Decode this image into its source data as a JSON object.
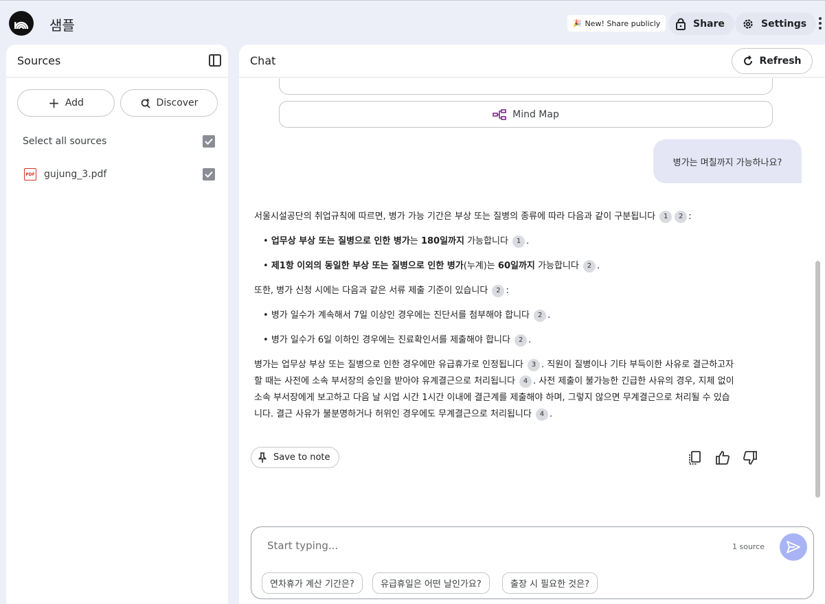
{
  "header": {
    "title": "샘플",
    "new_share": "New! Share publicly",
    "share_label": "Share",
    "settings_label": "Settings"
  },
  "sources": {
    "title": "Sources",
    "add_label": "Add",
    "discover_label": "Discover",
    "select_all_label": "Select all sources",
    "select_all_checked": true,
    "files": [
      {
        "name": "gujung_3.pdf",
        "type": "pdf",
        "checked": true
      }
    ]
  },
  "chat": {
    "title": "Chat",
    "refresh_label": "Refresh",
    "mind_map_label": "Mind Map",
    "user_question": "병가는 며칠까지 가능하나요?",
    "answer": {
      "intro": "서울시설공단의 취업규칙에 따르면, 병가 가능 기간은 부상 또는 질병의 종류에 따라 다음과 같이 구분됩니다",
      "b1_bold": "업무상 부상 또는 질병으로 인한 병가",
      "b1_mid": "는 ",
      "b1_bold2": "180일까지",
      "b1_end": " 가능합니다",
      "b2_bold": "제1항 이외의 동일한 부상 또는 질병으로 인한 병가",
      "b2_mid": "(누계)는 ",
      "b2_bold2": "60일까지",
      "b2_end": " 가능합니다",
      "docs_intro": "또한, 병가 신청 시에는 다음과 같은 서류 제출 기준이 있습니다",
      "d1": "병가 일수가 계속해서 7일 이상인 경우에는 진단서를 첨부해야 합니다",
      "d2": "병가 일수가 6일 이하인 경우에는 진료확인서를 제출해야 합니다",
      "p_line1a": "병가는 업무상 부상 또는 질병으로 인한 경우에만 유급휴가로 인정됩니다",
      "p_line1b": ". 직원이 질병이나 기타 부득이한 사유로 결근하고자",
      "p_line2a": "할 때는 사전에 소속 부서장의 승인을 받아야 유계결근으로 처리됩니다",
      "p_line2b": ". 사전 제출이 불가능한 긴급한 사유의 경우, 지체 없이",
      "p_line3": "소속 부서장에게 보고하고 다음 날 시업 시간 1시간 이내에 결근계를 제출해야 하며, 그렇지 않으면 무계결근으로 처리될 수 있습",
      "p_line4": "니다. 결근 사유가 불분명하거나 허위인 경우에도 무계결근으로 처리됩니다",
      "cite1": "1",
      "cite2": "2",
      "cite3": "3",
      "cite4": "4",
      "colon": ":",
      "period": "."
    },
    "save_note_label": "Save to note",
    "composer": {
      "placeholder": "Start typing...",
      "source_count": "1 source"
    },
    "suggestions": [
      "연차휴가 계산 기간은?",
      "유급휴일은 어떤 날인가요?",
      "출장 시 필요한 것은?"
    ]
  },
  "colors": {
    "background": "#eceef8",
    "send_button": "#a8b4f5",
    "user_bubble": "#e4e6f6",
    "pdf_icon": "#d93025"
  }
}
